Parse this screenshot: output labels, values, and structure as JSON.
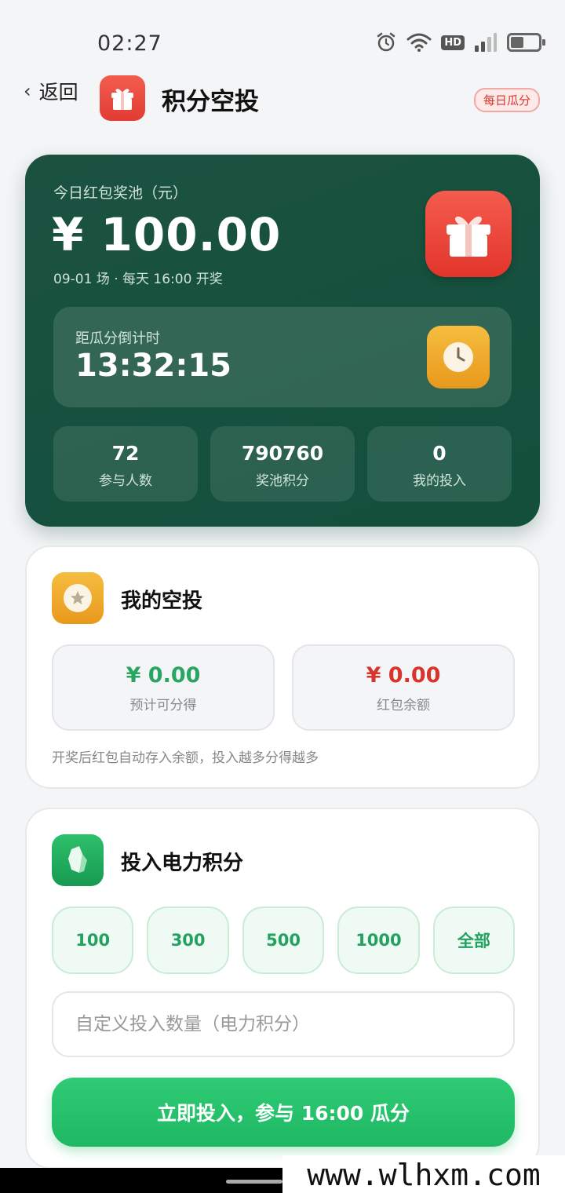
{
  "status_bar": {
    "time": "02:27",
    "hd_label": "HD"
  },
  "header": {
    "back_label": "返回",
    "title": "积分空投",
    "badge": "每日瓜分"
  },
  "pool": {
    "label": "今日红包奖池（元）",
    "amount": "¥ 100.00",
    "subtitle": "09-01 场 · 每天 16:00 开奖",
    "countdown_label": "距瓜分倒计时",
    "countdown": "13:32:15",
    "stats": [
      {
        "value": "72",
        "label": "参与人数"
      },
      {
        "value": "790760",
        "label": "奖池积分"
      },
      {
        "value": "0",
        "label": "我的投入"
      }
    ]
  },
  "my_airdrop": {
    "title": "我的空投",
    "estimate_value": "¥ 0.00",
    "estimate_label": "预计可分得",
    "balance_value": "¥ 0.00",
    "balance_label": "红包余额",
    "note": "开奖后红包自动存入余额，投入越多分得越多"
  },
  "invest": {
    "title": "投入电力积分",
    "chips": [
      "100",
      "300",
      "500",
      "1000",
      "全部"
    ],
    "placeholder": "自定义投入数量（电力积分）",
    "submit_label": "立即投入，参与 16:00 瓜分"
  },
  "watermark": "www.wlhxm.com",
  "colors": {
    "hero_bg": "#12503c",
    "green": "#27a561",
    "red": "#d8342c",
    "button": "#2ecb74"
  }
}
